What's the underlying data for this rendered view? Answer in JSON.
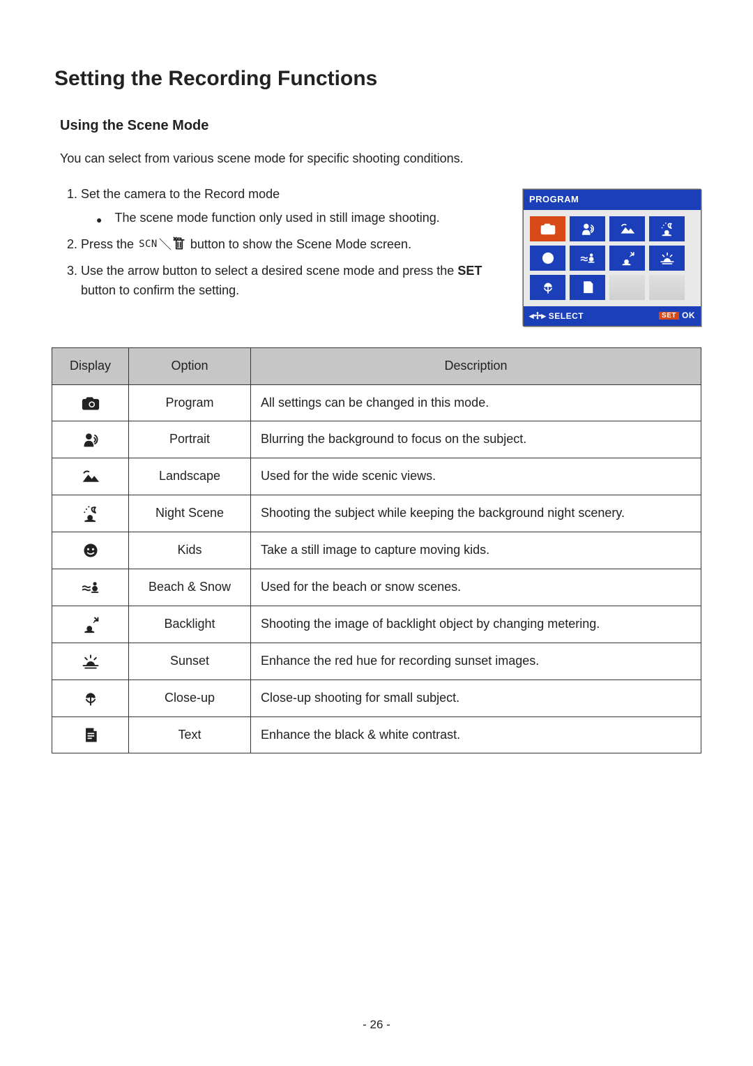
{
  "title": "Setting the Recording Functions",
  "subtitle": "Using the Scene Mode",
  "intro": "You can select from various scene mode for specific shooting conditions.",
  "steps": {
    "step1": "Set the camera to the Record mode",
    "step1_bullet": "The scene mode function only used in still image shooting.",
    "step2_a": "Press the",
    "step2_scn": "SCN",
    "step2_b": "button to show the Scene Mode screen.",
    "step3_a": "Use the arrow button to select a desired scene mode and press the",
    "step3_set": "SET",
    "step3_b": "button to confirm the setting."
  },
  "figure": {
    "title": "PROGRAM",
    "footer_select": "SELECT",
    "footer_set": "SET",
    "footer_ok": "OK"
  },
  "table": {
    "headers": {
      "display": "Display",
      "option": "Option",
      "description": "Description"
    },
    "rows": [
      {
        "icon": "program",
        "option": "Program",
        "desc": "All settings can be changed in this mode."
      },
      {
        "icon": "portrait",
        "option": "Portrait",
        "desc": "Blurring the background to focus on the subject."
      },
      {
        "icon": "landscape",
        "option": "Landscape",
        "desc": "Used for the wide scenic views."
      },
      {
        "icon": "nightscene",
        "option": "Night Scene",
        "desc": "Shooting the subject while keeping the background night scenery."
      },
      {
        "icon": "kids",
        "option": "Kids",
        "desc": "Take a still image to capture moving kids."
      },
      {
        "icon": "beachsnow",
        "option": "Beach & Snow",
        "desc": "Used for the beach or snow scenes."
      },
      {
        "icon": "backlight",
        "option": "Backlight",
        "desc": "Shooting the image of backlight object by changing metering."
      },
      {
        "icon": "sunset",
        "option": "Sunset",
        "desc": "Enhance the red hue for recording sunset images."
      },
      {
        "icon": "closeup",
        "option": "Close-up",
        "desc": "Close-up shooting for small subject."
      },
      {
        "icon": "text",
        "option": "Text",
        "desc": "Enhance the black & white contrast."
      }
    ]
  },
  "page_number": "- 26 -"
}
